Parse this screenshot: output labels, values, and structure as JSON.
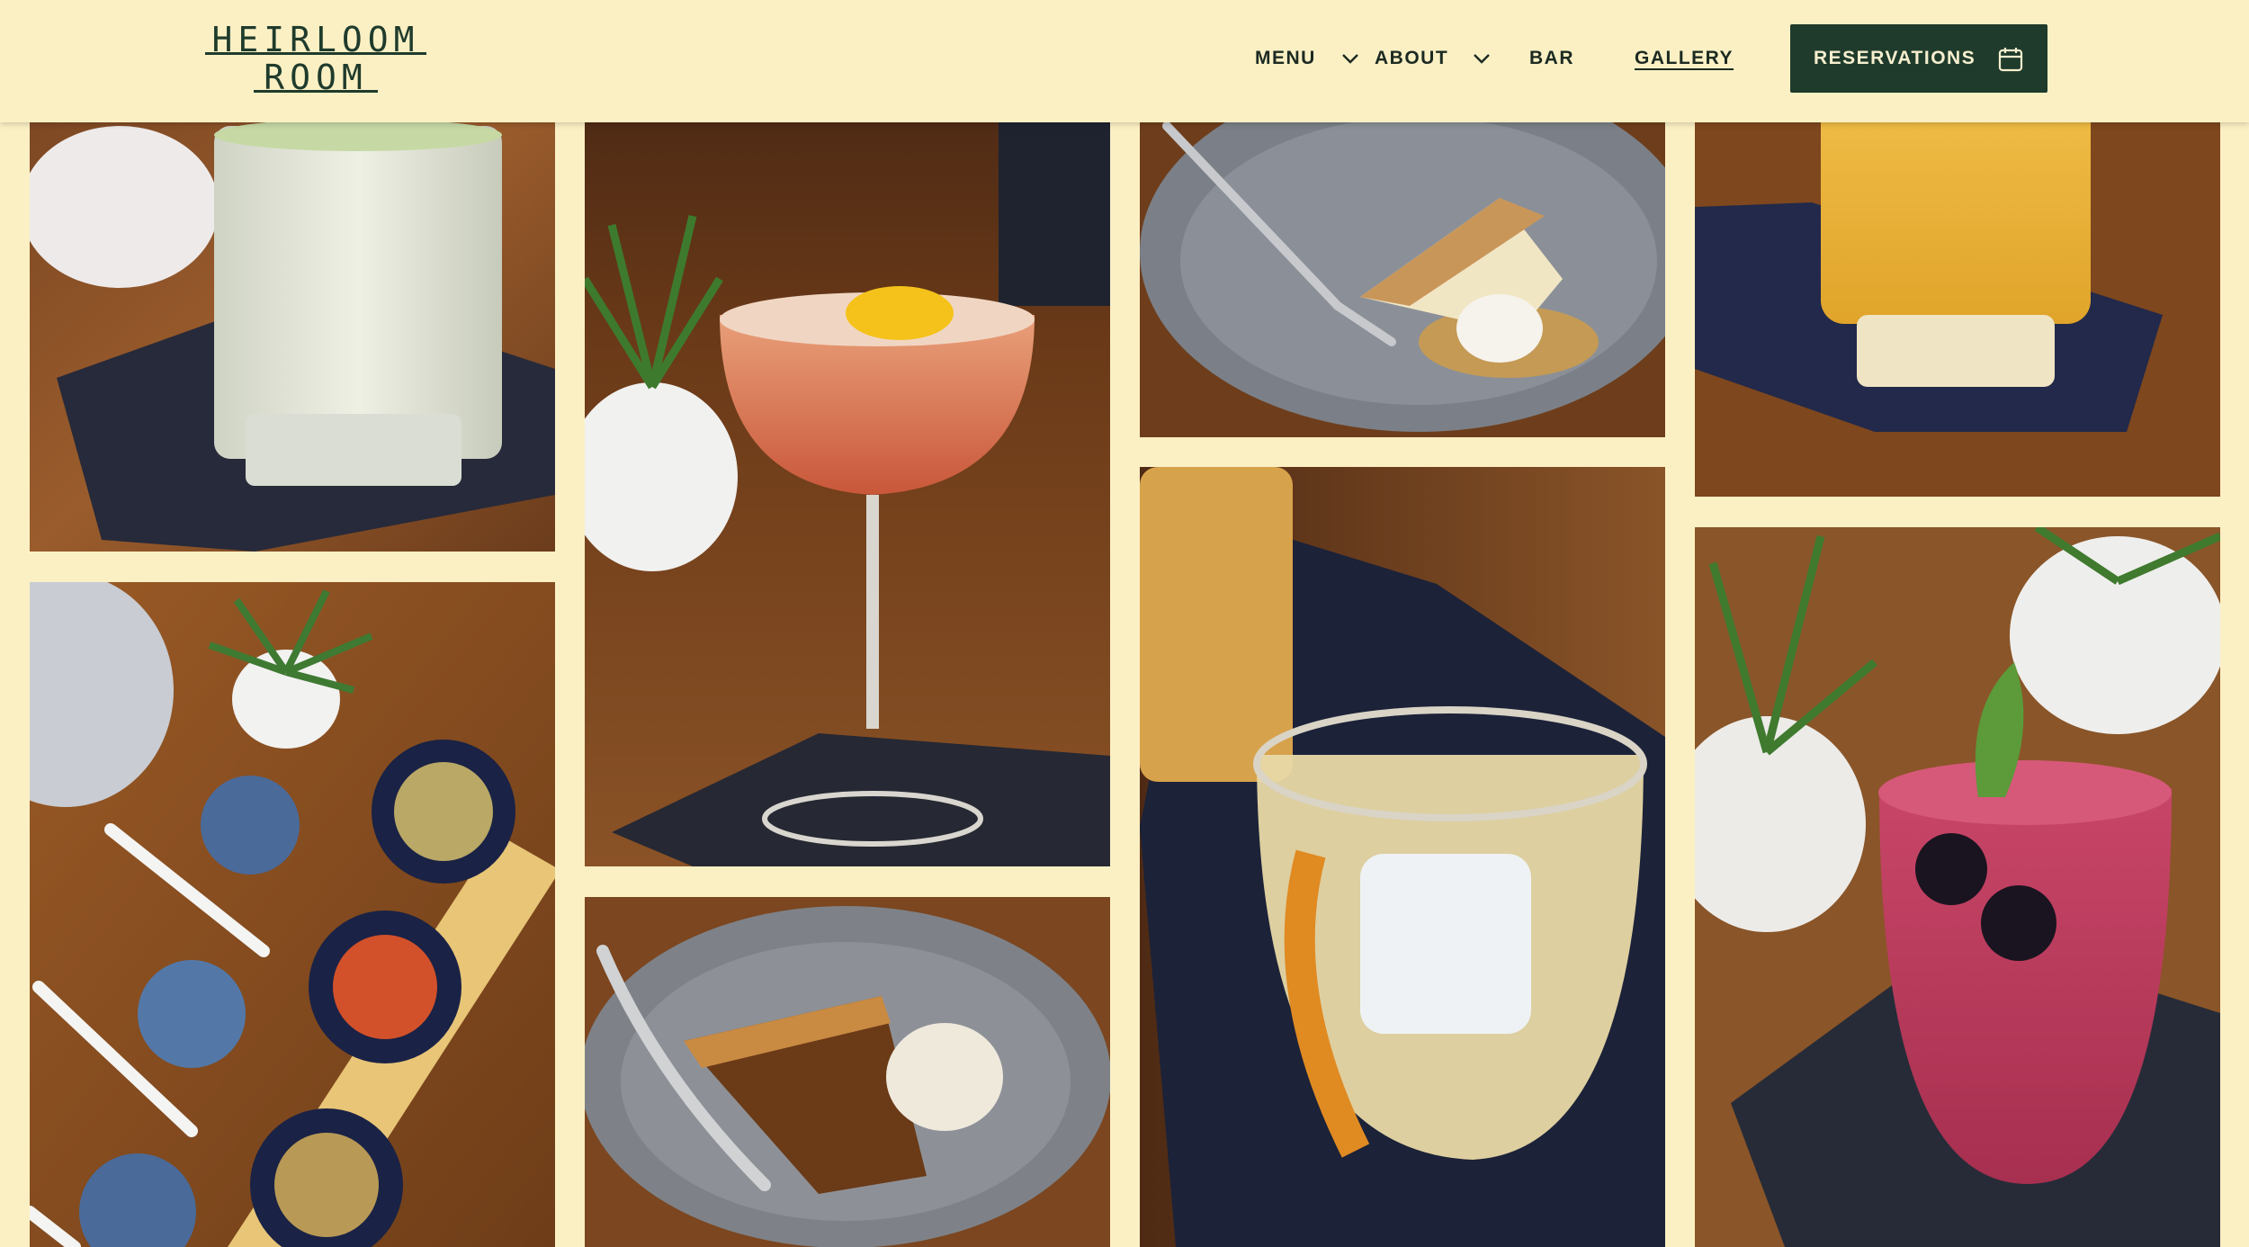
{
  "brand": {
    "line1": "HEIRLOOM",
    "line2": "ROOM"
  },
  "nav": {
    "menu": "MENU",
    "about": "ABOUT",
    "bar": "BAR",
    "gallery": "GALLERY",
    "reservations": "RESERVATIONS"
  },
  "icons": {
    "menu_chevron": "chevron-down-icon",
    "about_chevron": "chevron-down-icon",
    "reservations": "calendar-icon"
  },
  "colors": {
    "background": "#fbf0c4",
    "brand_green": "#1f3b2c",
    "button_text": "#f6efcf"
  },
  "gallery": {
    "photos": [
      "cucumber-cocktail",
      "orange-coupe-cocktail",
      "almond-cheesecake",
      "orange-highball",
      "condiment-board",
      "pecan-pie",
      "old-fashioned",
      "blackberry-mint-cocktail"
    ]
  }
}
